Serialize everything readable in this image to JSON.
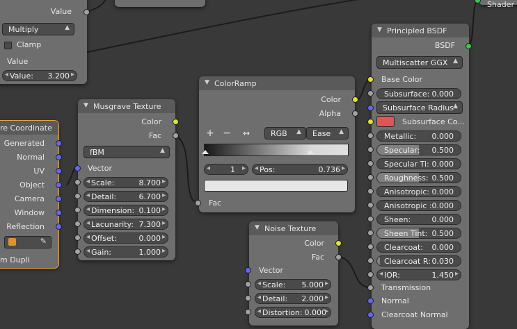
{
  "top_left_node": {
    "value_out_label": "Value",
    "blend_mode": "Multiply",
    "clamp_label": "Clamp",
    "value_in_label": "Value",
    "value_field": {
      "label": "Value:",
      "value": "3.200"
    }
  },
  "texture_coordinate": {
    "title": "re Coordinate",
    "outputs": [
      "Generated",
      "Normal",
      "UV",
      "Object",
      "Camera",
      "Window",
      "Reflection"
    ],
    "from_dupli_label": "m Dupli"
  },
  "musgrave": {
    "title": "Musgrave Texture",
    "out_color": "Color",
    "out_fac": "Fac",
    "type": "fBM",
    "in_vector": "Vector",
    "fields": [
      {
        "label": "Scale:",
        "value": "8.700"
      },
      {
        "label": "Detail:",
        "value": "6.700"
      },
      {
        "label": "Dimension:",
        "value": "0.100"
      },
      {
        "label": "Lacunarity:",
        "value": "7.300"
      },
      {
        "label": "Offset:",
        "value": "0.000"
      },
      {
        "label": "Gain:",
        "value": "1.000"
      }
    ]
  },
  "colorramp": {
    "title": "ColorRamp",
    "out_color": "Color",
    "out_alpha": "Alpha",
    "add_label": "+",
    "remove_label": "−",
    "flip_label": "↔",
    "color_mode": "RGB",
    "interpolation": "Ease",
    "stop_index": "1",
    "pos_label": "Pos:",
    "pos_value": "0.736",
    "in_fac": "Fac"
  },
  "noise": {
    "title": "Noise Texture",
    "out_color": "Color",
    "out_fac": "Fac",
    "in_vector": "Vector",
    "fields": [
      {
        "label": "Scale:",
        "value": "5.000"
      },
      {
        "label": "Detail:",
        "value": "2.000"
      },
      {
        "label": "Distortion:",
        "value": "0.000"
      }
    ]
  },
  "bsdf": {
    "title": "Principled BSDF",
    "out_bsdf": "BSDF",
    "distribution": "Multiscatter GGX",
    "base_color": "Base Color",
    "subsurface": {
      "label": "Subsurface:",
      "value": "0.000"
    },
    "subsurface_method": "Subsurface Radius",
    "subsurface_color": "Subsurface Co...",
    "fields": [
      {
        "label": "Metallic:",
        "value": "0.000"
      },
      {
        "label": "Specular:",
        "value": "0.500"
      },
      {
        "label": "Specular Ti:",
        "value": "0.000"
      },
      {
        "label": "Roughness:",
        "value": "0.500"
      },
      {
        "label": "Anisotropic:",
        "value": "0.000"
      },
      {
        "label": "Anisotropic :",
        "value": "0.000"
      },
      {
        "label": "Sheen:",
        "value": "0.000"
      },
      {
        "label": "Sheen Tint:",
        "value": "0.500"
      },
      {
        "label": "Clearcoat:",
        "value": "0.000"
      },
      {
        "label": "Clearcoat R:",
        "value": "0.030"
      },
      {
        "label": "IOR:",
        "value": "1.450"
      }
    ],
    "transmission": "Transmission",
    "normal": "Normal",
    "clearcoat_normal": "Clearcoat Normal"
  },
  "output_node": {
    "title": "Shader"
  },
  "colors": {
    "background": "#393939",
    "node_body": "#6e6e6e",
    "socket_color": "#e2e22a",
    "socket_float": "#a2a2a2",
    "socket_vector": "#6565ee",
    "socket_shader": "#3ac54a",
    "subsurface_swatch": "#e05555",
    "active_outline": "#e7a34e"
  }
}
